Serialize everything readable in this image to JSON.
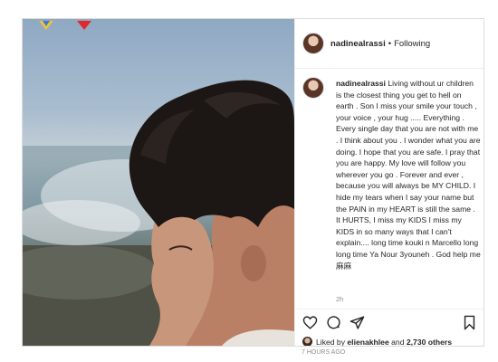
{
  "post": {
    "username": "nadinealrassi",
    "separator": "•",
    "follow_status": "Following",
    "caption_username": "nadinealrassi",
    "caption_text": "Living without ur children is the closest thing you get to hell on earth . Son I miss your smile your touch , your voice , your hug ..... Everything . Every single day that you are not with me . I think about you . I wonder what you are doing. I hope that you are safe. I pray that you are happy. My love will follow you wherever you go . Forever and ever , because you will always be MY CHILD. I hide my tears when I say your name but the PAIN in my HEART is still the same . It HURTS, I miss my KIDS I miss my KIDS in so many ways that I can't explain.... long time kouki n Marcello long long time Ya Nour 3youneh . God help me ⿇⿇",
    "time": "2h",
    "likes_prefix": "Liked by",
    "likes_user": "elienakhlee",
    "likes_conj": "and",
    "likes_count": "2,730 others",
    "posted_ago": "7 HOURS AGO"
  },
  "icons": {
    "like": "heart-icon",
    "comment": "comment-icon",
    "share": "share-icon",
    "save": "bookmark-icon"
  },
  "colors": {
    "border": "#dbdbdb",
    "text": "#262626",
    "muted": "#8e8e8e"
  }
}
